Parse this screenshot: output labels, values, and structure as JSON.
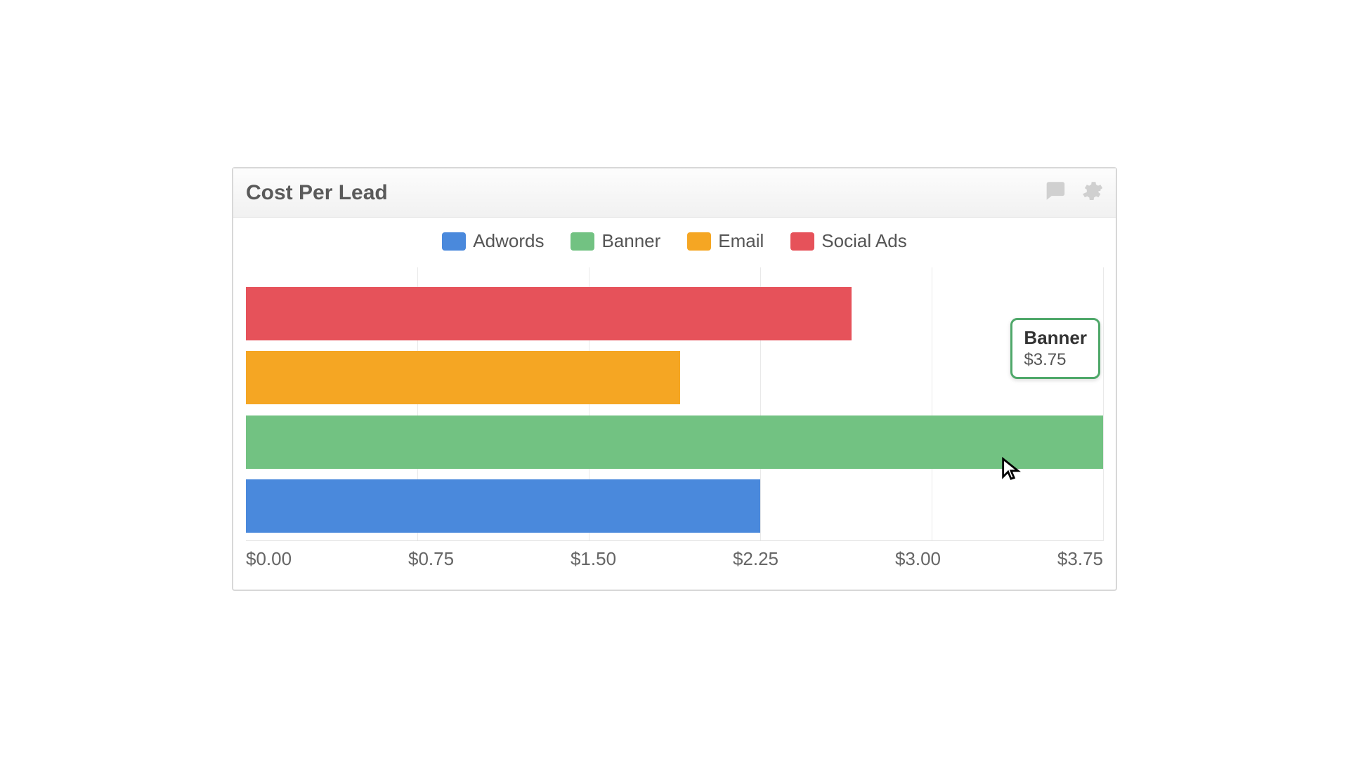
{
  "panel": {
    "title": "Cost Per Lead"
  },
  "legend": [
    {
      "name": "Adwords",
      "color": "#4a89dc"
    },
    {
      "name": "Banner",
      "color": "#72c282"
    },
    {
      "name": "Email",
      "color": "#f5a623"
    },
    {
      "name": "Social Ads",
      "color": "#e6525a"
    }
  ],
  "tooltip": {
    "title": "Banner",
    "value": "$3.75"
  },
  "chart_data": {
    "type": "bar",
    "orientation": "horizontal",
    "title": "Cost Per Lead",
    "xlabel": "",
    "ylabel": "",
    "xlim": [
      0,
      3.75
    ],
    "x_ticks": [
      "$0.00",
      "$0.75",
      "$1.50",
      "$2.25",
      "$3.00",
      "$3.75"
    ],
    "series": [
      {
        "name": "Social Ads",
        "value": 2.65,
        "color": "#e6525a"
      },
      {
        "name": "Email",
        "value": 1.9,
        "color": "#f5a623"
      },
      {
        "name": "Banner",
        "value": 3.75,
        "color": "#72c282"
      },
      {
        "name": "Adwords",
        "value": 2.25,
        "color": "#4a89dc"
      }
    ],
    "tooltip_shown": {
      "series": "Banner",
      "value_text": "$3.75"
    }
  }
}
